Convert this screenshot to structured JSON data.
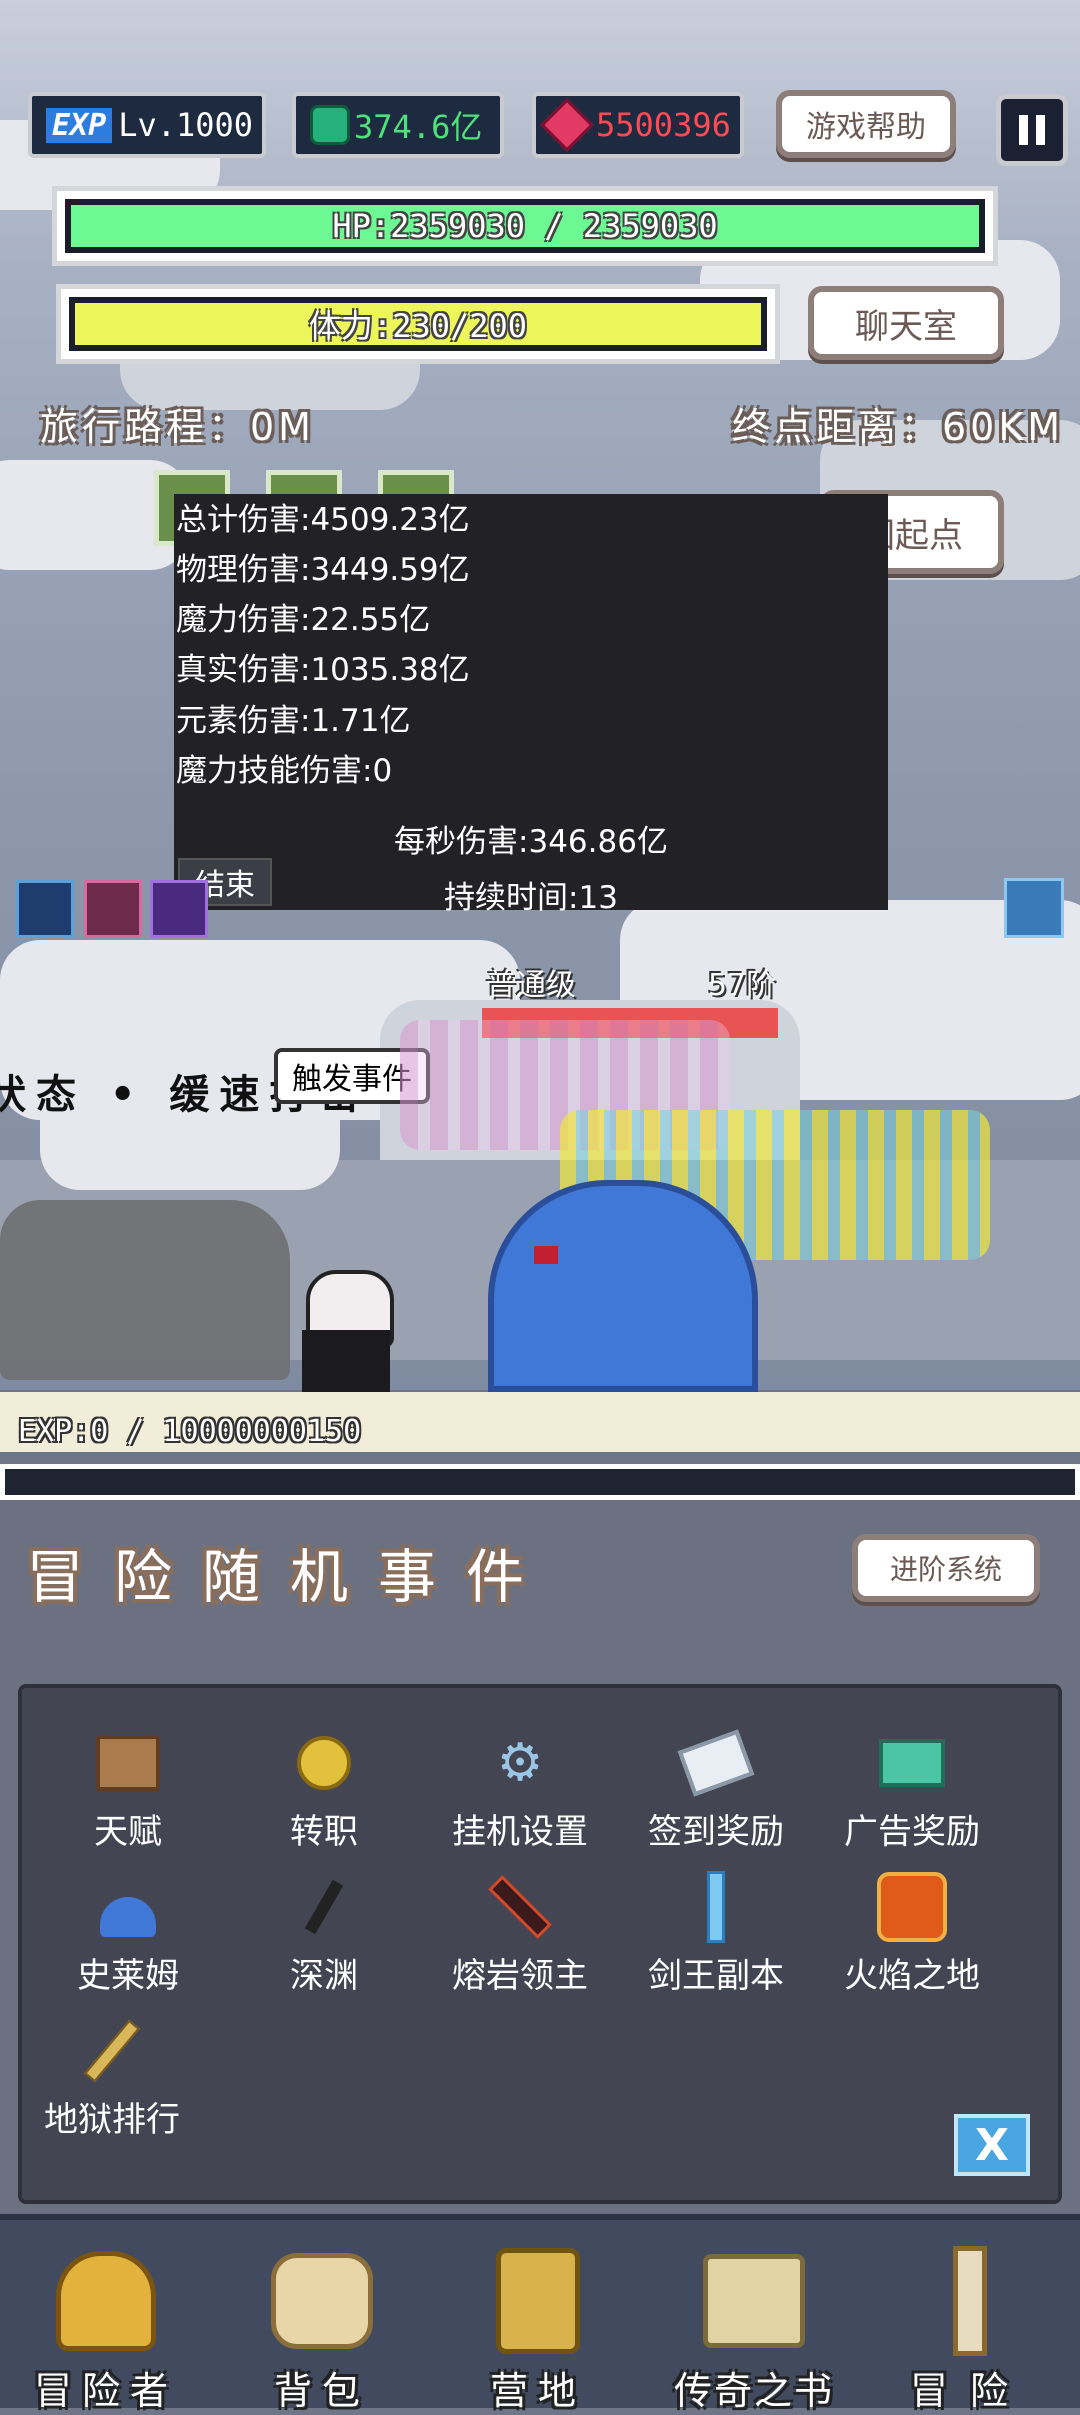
{
  "top": {
    "exp_badge": "EXP",
    "level": "Lv.1000",
    "gems": "374.6亿",
    "rubies": "5500396",
    "help_label": "游戏帮助",
    "pause_icon": "pause-icon"
  },
  "hp": {
    "text": "HP:2359030 / 2359030",
    "fill": 1.0,
    "color": "#6cf893"
  },
  "stamina": {
    "text": "体力:230/200",
    "fill": 1.0,
    "color": "#ecf55a"
  },
  "chat_label": "聊天室",
  "travel": {
    "distance_label": "旅行路程：0M",
    "remaining_label": "终点距离：60KM"
  },
  "return_label": "回起点",
  "damage_panel": {
    "total": "总计伤害:4509.23亿",
    "physical": "物理伤害:3449.59亿",
    "magic": "魔力伤害:22.55亿",
    "true_dmg": "真实伤害:1035.38亿",
    "element": "元素伤害:1.71亿",
    "magic_skill": "魔力技能伤害:0",
    "dps": "每秒伤害:346.86亿",
    "duration": "持续时间:13",
    "end_label": "结束"
  },
  "battle": {
    "status_text": "状态 • 缓速打击",
    "event_label": "触发事件",
    "enemy_rank": "普通级",
    "enemy_tier": "57阶"
  },
  "exp_bar": {
    "text": "EXP:0 / 10000000150",
    "fill": 0.0
  },
  "section": {
    "title": "冒险随机事件",
    "advance_label": "进阶系统"
  },
  "menu": {
    "items": [
      {
        "label": "天赋",
        "icon": "book-icon"
      },
      {
        "label": "转职",
        "icon": "orb-icon"
      },
      {
        "label": "挂机设置",
        "icon": "gear-icon"
      },
      {
        "label": "签到奖励",
        "icon": "scroll-icon"
      },
      {
        "label": "广告奖励",
        "icon": "chest-icon"
      },
      {
        "label": "史莱姆",
        "icon": "slime-icon"
      },
      {
        "label": "深渊",
        "icon": "abyss-icon"
      },
      {
        "label": "熔岩领主",
        "icon": "lava-sword-icon"
      },
      {
        "label": "剑王副本",
        "icon": "blue-sword-icon"
      },
      {
        "label": "火焰之地",
        "icon": "fire-icon"
      },
      {
        "label": "地狱排行",
        "icon": "staff-icon"
      }
    ],
    "close_label": "X"
  },
  "nav": [
    {
      "label": "冒险者",
      "icon": "helmet-icon"
    },
    {
      "label": "背包",
      "icon": "backpack-icon"
    },
    {
      "label": "营地",
      "icon": "camp-icon"
    },
    {
      "label": "传奇之书",
      "icon": "legend-book-icon"
    },
    {
      "label": "冒险",
      "icon": "adventure-sword-icon"
    }
  ]
}
